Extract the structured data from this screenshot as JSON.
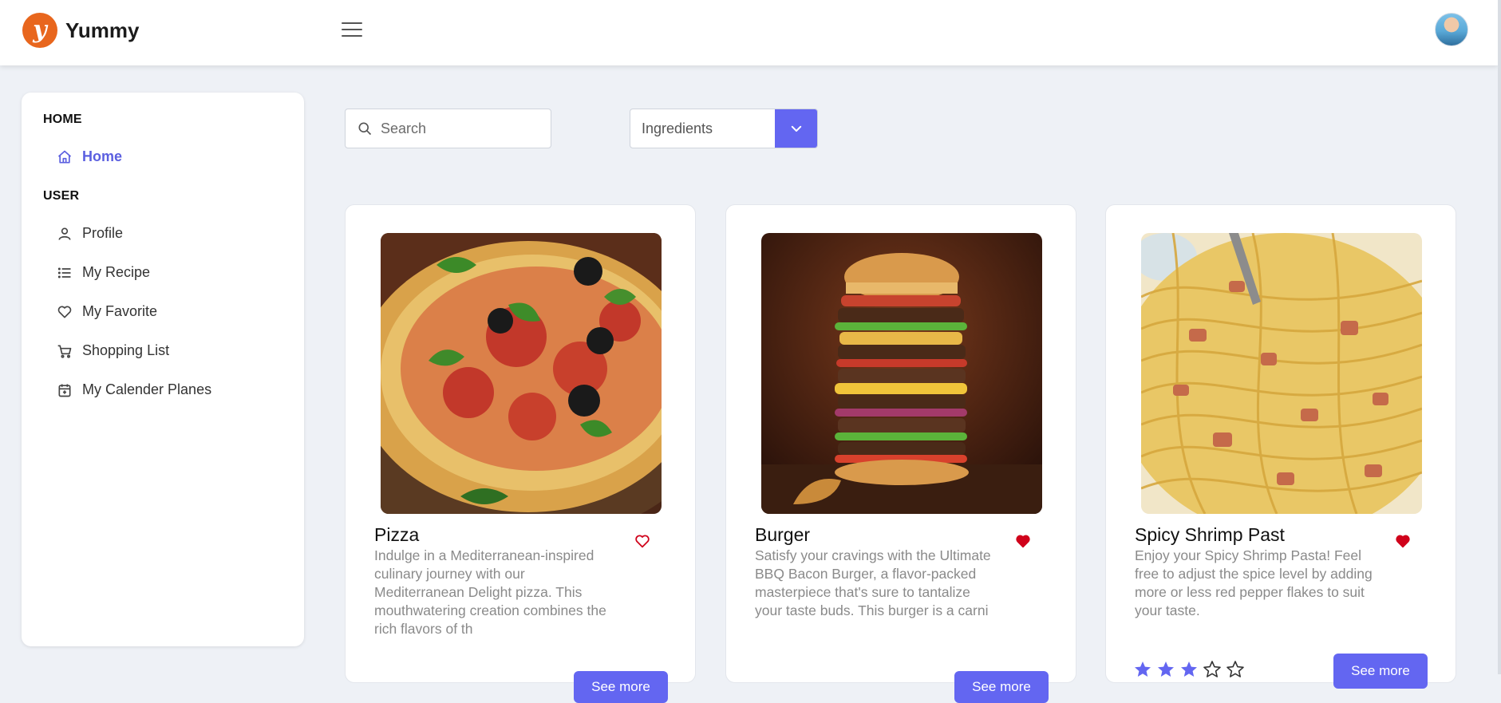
{
  "header": {
    "brand_name": "Yummy",
    "brand_logo_letter": "y",
    "menu_icon": "hamburger-icon",
    "avatar_icon": "user-avatar"
  },
  "sidebar": {
    "sections": [
      {
        "label": "HOME",
        "items": [
          {
            "label": "Home",
            "icon": "home-icon",
            "active": true
          }
        ]
      },
      {
        "label": "USER",
        "items": [
          {
            "label": "Profile",
            "icon": "user-icon"
          },
          {
            "label": "My Recipe",
            "icon": "list-icon"
          },
          {
            "label": "My Favorite",
            "icon": "heart-icon"
          },
          {
            "label": "Shopping List",
            "icon": "cart-icon"
          },
          {
            "label": "My Calender Planes",
            "icon": "calendar-icon"
          }
        ]
      }
    ]
  },
  "filters": {
    "search_placeholder": "Search",
    "search_value": "",
    "select_value": "Ingredients"
  },
  "cards": [
    {
      "title": "Pizza",
      "favorited": false,
      "description": "Indulge in a Mediterranean-inspired culinary journey with our Mediterranean Delight pizza. This mouthwatering creation combines the rich flavors of th",
      "button_label": "See more"
    },
    {
      "title": "Burger",
      "favorited": true,
      "description": "Satisfy your cravings with the Ultimate BBQ Bacon Burger, a flavor-packed masterpiece that's sure to tantalize your taste buds. This burger is a carni",
      "button_label": "See more"
    },
    {
      "title": "Spicy Shrimp Past",
      "favorited": true,
      "description": "Enjoy your Spicy Shrimp Pasta! Feel free to adjust the spice level by adding more or less red pepper flakes to suit your taste.",
      "rating": 3,
      "rating_max": 5,
      "button_label": "See more"
    }
  ],
  "colors": {
    "accent": "#6366f1",
    "active_nav": "#5b5fe0",
    "heart": "#d0021b",
    "brand_logo": "#e8661d"
  }
}
